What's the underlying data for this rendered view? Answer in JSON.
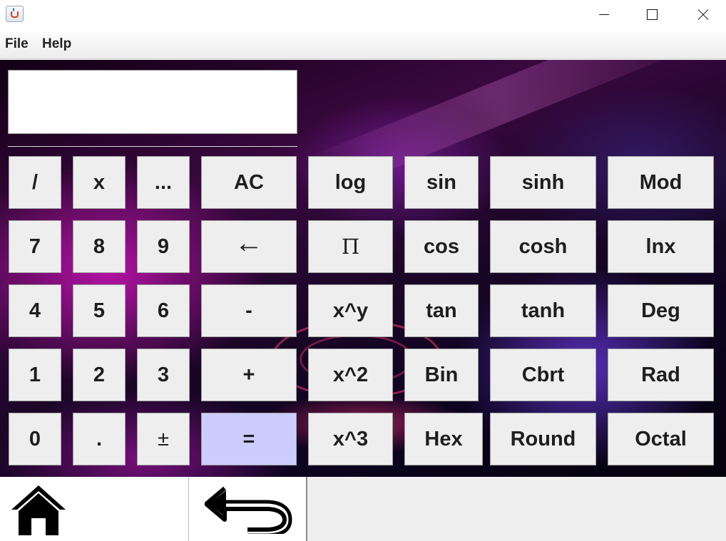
{
  "window": {
    "app_icon": "java-cup-icon",
    "controls": [
      "minimize-icon",
      "maximize-icon",
      "close-icon"
    ]
  },
  "menu": {
    "file": "File",
    "help": "Help"
  },
  "display": {
    "value": ""
  },
  "keys": {
    "divide": "/",
    "multiply": "x",
    "ellipsis": "...",
    "ac": "AC",
    "log": "log",
    "sin": "sin",
    "sinh": "sinh",
    "mod": "Mod",
    "seven": "7",
    "eight": "8",
    "nine": "9",
    "backspace": "←",
    "pi": "Π",
    "cos": "cos",
    "cosh": "cosh",
    "lnx": "lnx",
    "four": "4",
    "five": "5",
    "six": "6",
    "minus": "-",
    "pow_y": "x^y",
    "tan": "tan",
    "tanh": "tanh",
    "deg": "Deg",
    "one": "1",
    "two": "2",
    "three": "3",
    "plus": "+",
    "square": "x^2",
    "bin": "Bin",
    "cbrt": "Cbrt",
    "rad": "Rad",
    "zero": "0",
    "dot": ".",
    "plus_minus": "±",
    "equals": "=",
    "cube": "x^3",
    "hex": "Hex",
    "round": "Round",
    "octal": "Octal"
  },
  "colors": {
    "key_bg": "#eeeeee",
    "equals_bg": "#ccccff"
  },
  "bottom": {
    "home_icon": "home-icon",
    "back_icon": "back-arrow-icon"
  }
}
